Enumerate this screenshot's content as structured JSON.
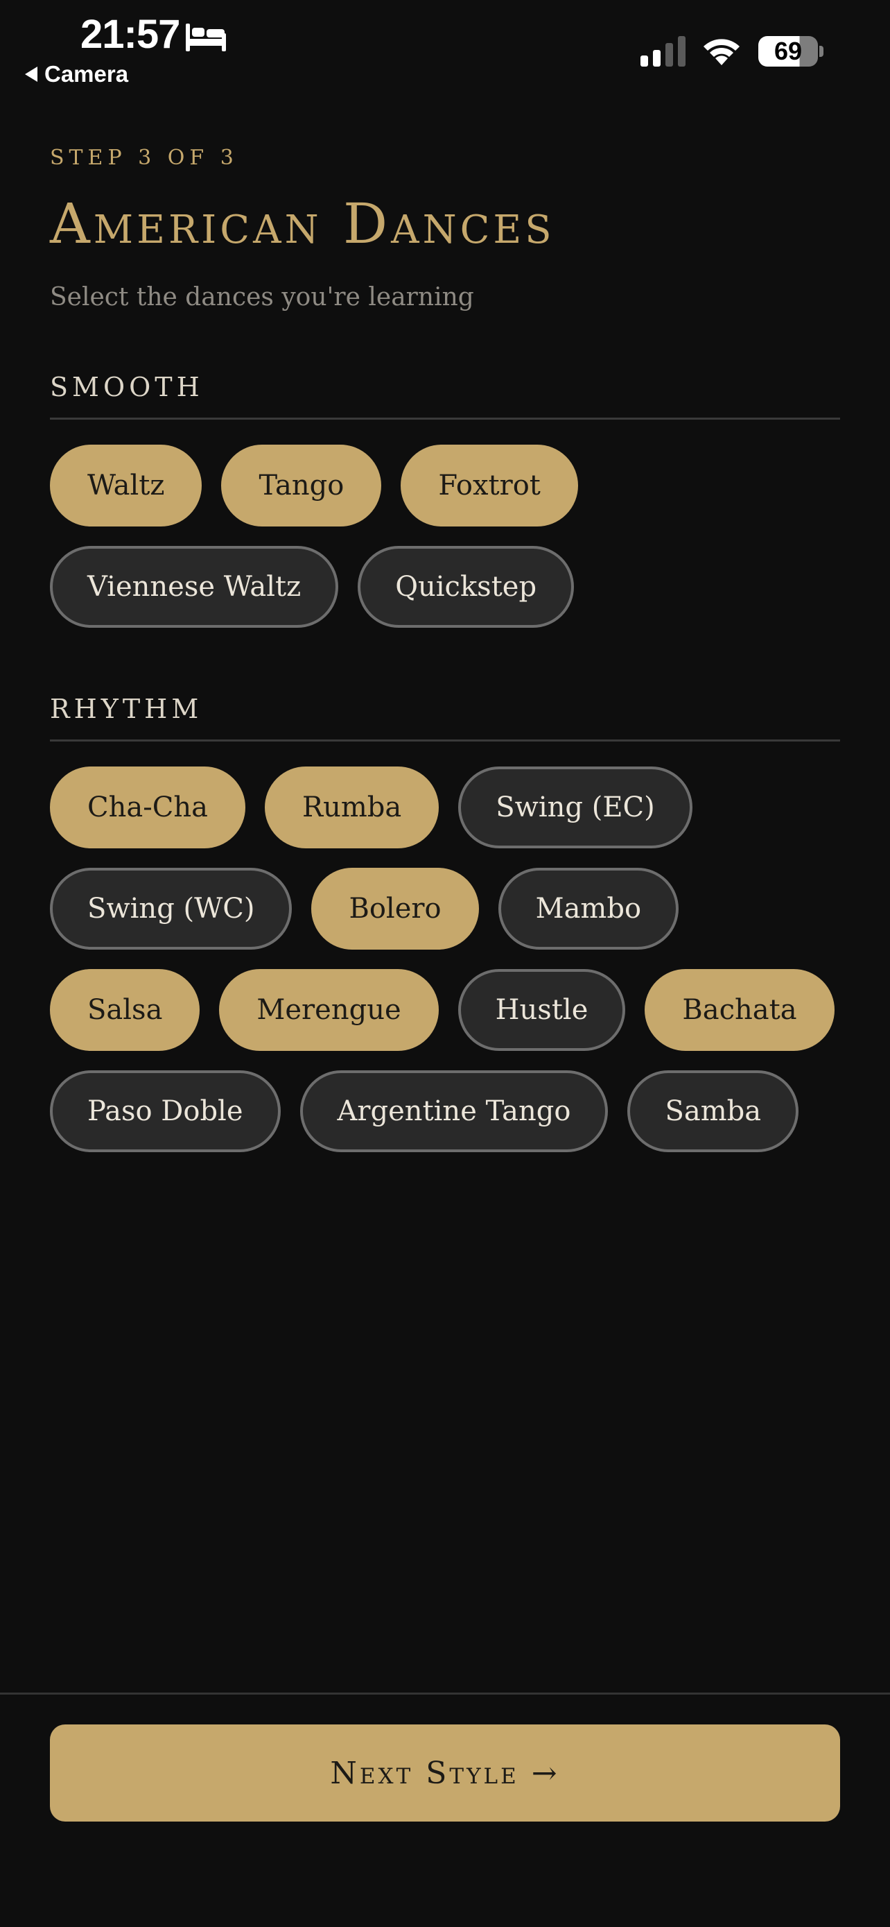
{
  "status_bar": {
    "time": "21:57",
    "back_label": "Camera",
    "battery_percent": "69",
    "battery_level": 0.69,
    "icons": [
      "bed-icon",
      "signal-icon",
      "wifi-icon",
      "battery-icon"
    ]
  },
  "header": {
    "step": "STEP 3 OF 3",
    "title": "American Dances",
    "subtitle": "Select the dances you're learning"
  },
  "sections": {
    "smooth": {
      "title": "SMOOTH",
      "dances": [
        {
          "label": "Waltz",
          "selected": true
        },
        {
          "label": "Tango",
          "selected": true
        },
        {
          "label": "Foxtrot",
          "selected": true
        },
        {
          "label": "Viennese Waltz",
          "selected": false
        },
        {
          "label": "Quickstep",
          "selected": false
        }
      ]
    },
    "rhythm": {
      "title": "RHYTHM",
      "dances": [
        {
          "label": "Cha-Cha",
          "selected": true
        },
        {
          "label": "Rumba",
          "selected": true
        },
        {
          "label": "Swing (EC)",
          "selected": false
        },
        {
          "label": "Swing (WC)",
          "selected": false
        },
        {
          "label": "Bolero",
          "selected": true
        },
        {
          "label": "Mambo",
          "selected": false
        },
        {
          "label": "Salsa",
          "selected": true
        },
        {
          "label": "Merengue",
          "selected": true
        },
        {
          "label": "Hustle",
          "selected": false
        },
        {
          "label": "Bachata",
          "selected": true
        },
        {
          "label": "Paso Doble",
          "selected": false
        },
        {
          "label": "Argentine Tango",
          "selected": false
        },
        {
          "label": "Samba",
          "selected": false
        }
      ]
    }
  },
  "footer": {
    "next_label": "Next Style →"
  },
  "colors": {
    "background": "#0e0e0e",
    "accent_gold": "#c6a86c",
    "chip_unselected_bg": "#292929",
    "chip_unselected_border": "#6d6d6d",
    "muted_text": "#8f8b84"
  }
}
